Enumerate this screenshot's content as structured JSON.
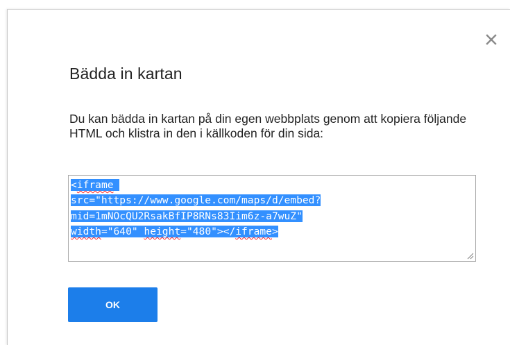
{
  "dialog": {
    "title": "Bädda in kartan",
    "description": "Du kan bädda in kartan på din egen webbplats genom att kopiera följande HTML och klistra in den i källkoden för din sida:",
    "close_icon": "close-icon",
    "embed": {
      "line1_a": "<",
      "line1_b": "iframe",
      "line2": "src=\"https://www.google.com/maps/d/embed?",
      "line3": "mid=1mNOcQU2RsakBfIP8RNs83Iim6z-a7wuZ\"",
      "line4_a": "width",
      "line4_b": "=\"640\" ",
      "line4_c": "height",
      "line4_d": "=\"480\"></",
      "line4_e": "iframe",
      "line4_f": ">"
    },
    "ok_label": "OK"
  },
  "colors": {
    "accent": "#1c7eea",
    "selection": "#3390ff",
    "spellcheck": "#ff2a2a"
  }
}
